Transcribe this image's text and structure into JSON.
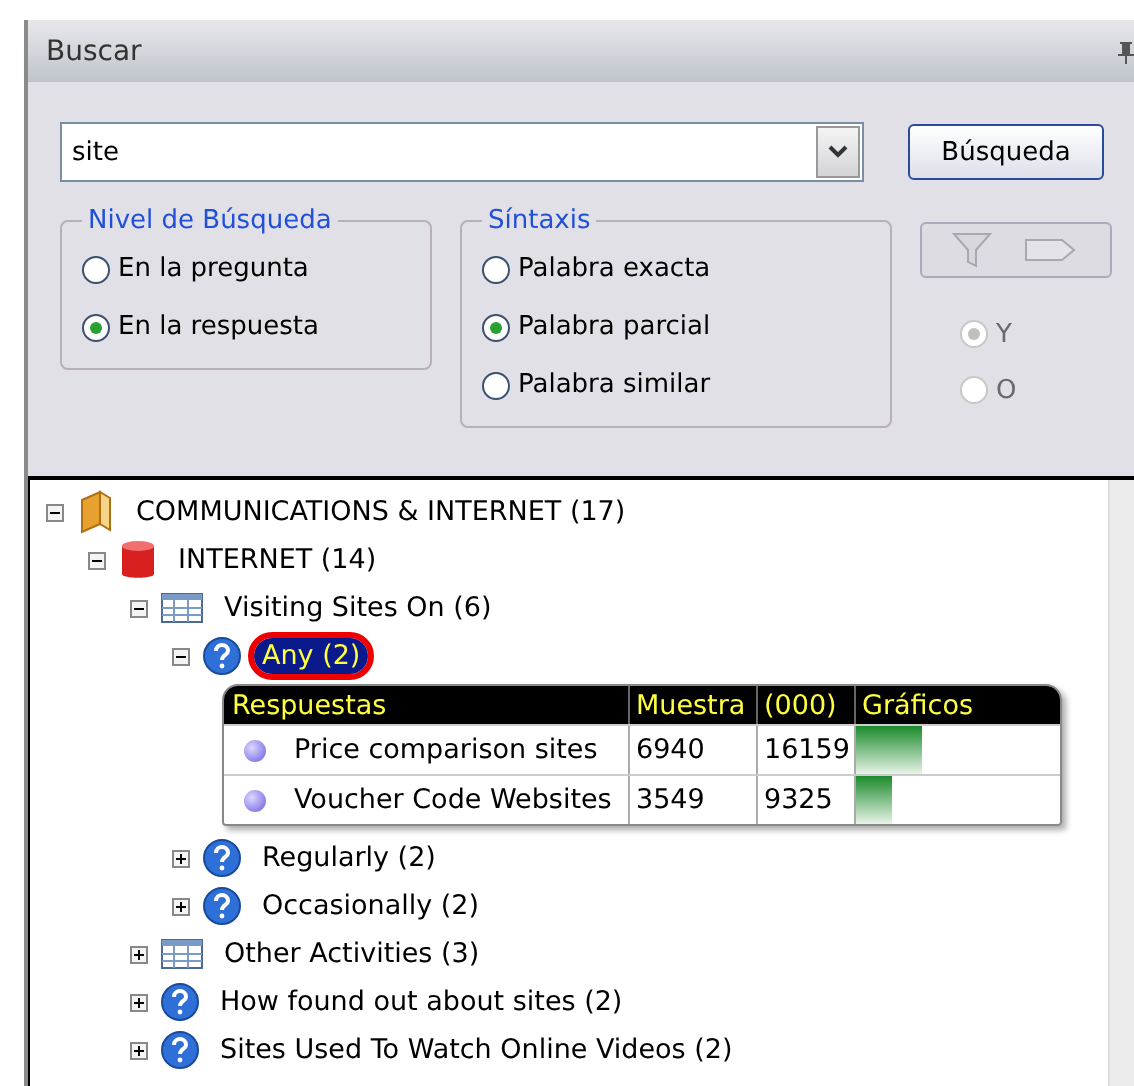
{
  "panel": {
    "title": "Buscar"
  },
  "search": {
    "value": "site",
    "button": "Búsqueda"
  },
  "level_group": {
    "title": "Nivel de Búsqueda",
    "options": [
      {
        "label": "En la pregunta",
        "selected": false
      },
      {
        "label": "En la respuesta",
        "selected": true
      }
    ]
  },
  "syntax_group": {
    "title": "Síntaxis",
    "options": [
      {
        "label": "Palabra exacta",
        "selected": false
      },
      {
        "label": "Palabra parcial",
        "selected": true
      },
      {
        "label": "Palabra similar",
        "selected": false
      }
    ]
  },
  "logic_options": [
    {
      "label": "Y",
      "selected": true,
      "disabled": true
    },
    {
      "label": "O",
      "selected": false,
      "disabled": true
    }
  ],
  "tree": [
    {
      "label": "COMMUNICATIONS & INTERNET (17)",
      "kind": "folder",
      "expanded": true,
      "selected": false,
      "children": [
        {
          "label": "INTERNET (14)",
          "kind": "database",
          "expanded": true,
          "selected": false,
          "children": [
            {
              "label": "Visiting Sites On (6)",
              "kind": "table",
              "expanded": true,
              "selected": false,
              "children": [
                {
                  "label": "Any (2)",
                  "kind": "question",
                  "expanded": true,
                  "selected": true,
                  "results": {
                    "columns": [
                      "Respuestas",
                      "Muestra",
                      "(000)",
                      "Gráficos"
                    ],
                    "rows": [
                      {
                        "answer": "Price comparison sites",
                        "sample": "6940",
                        "count": "16159",
                        "level": 0.32
                      },
                      {
                        "answer": "Voucher Code Websites",
                        "sample": "3549",
                        "count": "9325",
                        "level": 0.18
                      }
                    ]
                  }
                },
                {
                  "label": "Regularly (2)",
                  "kind": "question",
                  "expanded": false,
                  "selected": false
                },
                {
                  "label": "Occasionally (2)",
                  "kind": "question",
                  "expanded": false,
                  "selected": false
                }
              ]
            },
            {
              "label": "Other Activities (3)",
              "kind": "table",
              "expanded": false,
              "selected": false
            },
            {
              "label": "How found out about sites (2)",
              "kind": "question",
              "expanded": false,
              "selected": false
            },
            {
              "label": "Sites Used To Watch Online Videos (2)",
              "kind": "question",
              "expanded": false,
              "selected": false
            }
          ]
        }
      ]
    }
  ]
}
